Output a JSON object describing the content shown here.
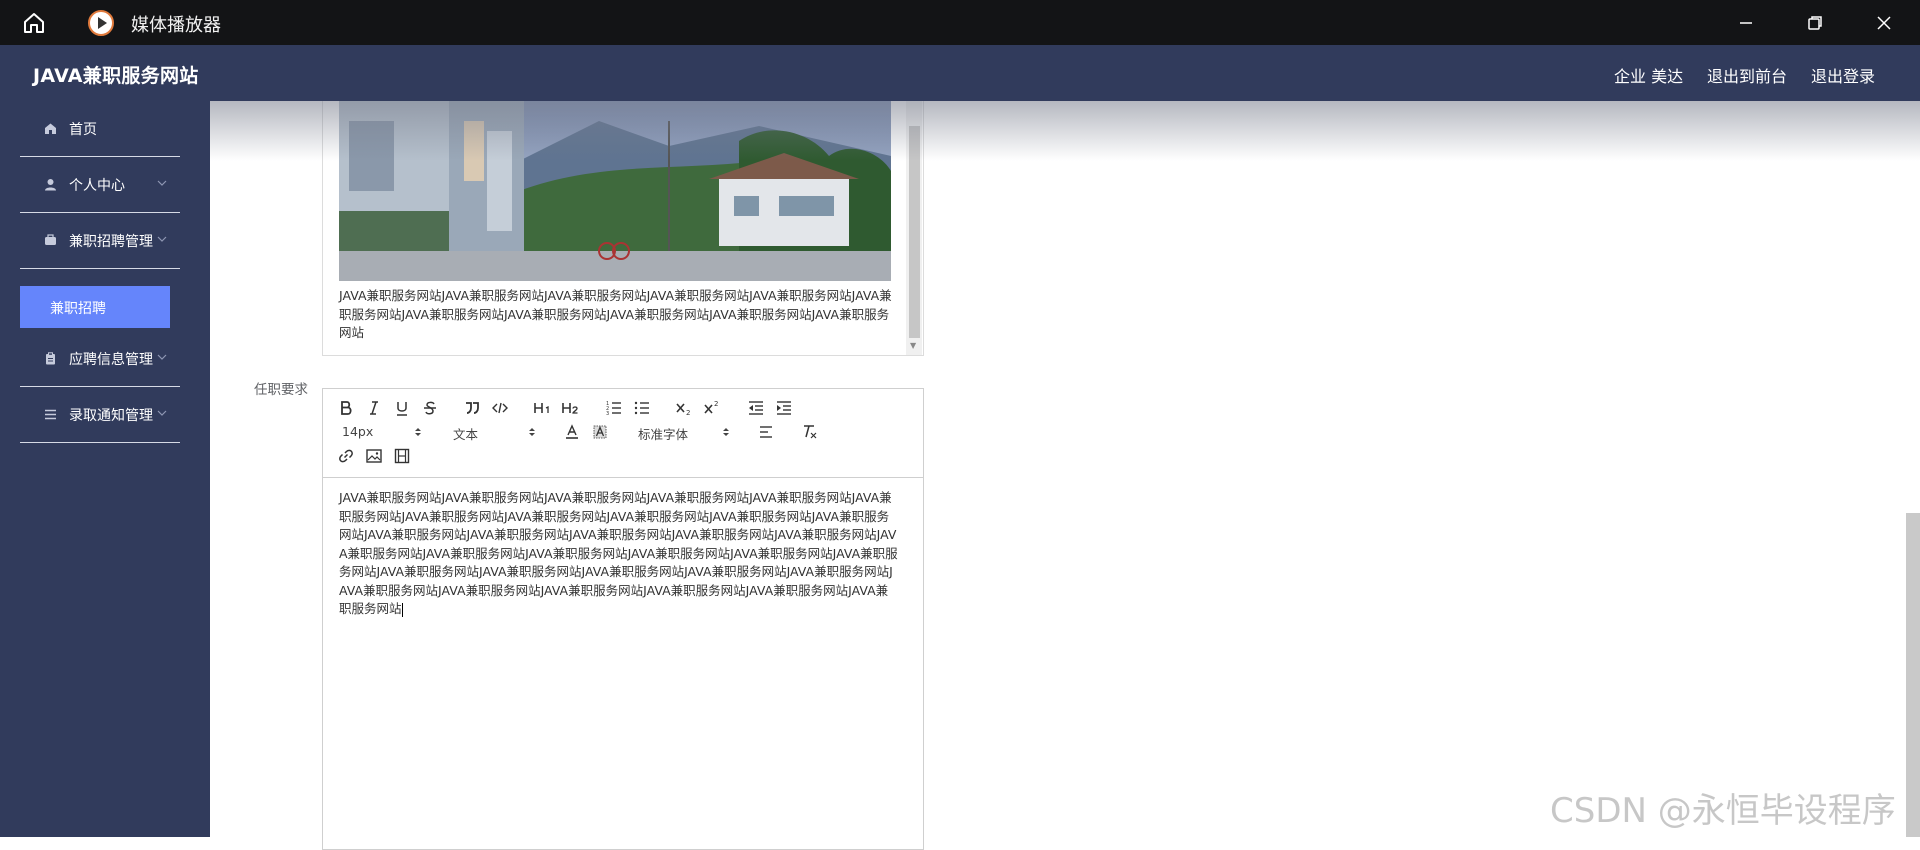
{
  "window": {
    "title": "媒体播放器",
    "icons": [
      "home-icon",
      "play-icon",
      "minimize-icon",
      "restore-icon",
      "close-icon"
    ]
  },
  "header": {
    "brand": "JAVA兼职服务网站",
    "user": "企业 美达",
    "to_front": "退出到前台",
    "logout": "退出登录"
  },
  "sidebar": {
    "items": [
      {
        "label": "首页",
        "icon": "home-icon"
      },
      {
        "label": "个人中心",
        "icon": "user-icon",
        "expandable": true
      },
      {
        "label": "兼职招聘管理",
        "icon": "briefcase-icon",
        "expandable": true
      },
      {
        "label": "应聘信息管理",
        "icon": "clipboard-icon",
        "expandable": true
      },
      {
        "label": "录取通知管理",
        "icon": "list-icon",
        "expandable": true
      }
    ],
    "active_sub": "兼职招聘"
  },
  "upper_editor": {
    "text": "JAVA兼职服务网站JAVA兼职服务网站JAVA兼职服务网站JAVA兼职服务网站JAVA兼职服务网站JAVA兼职服务网站JAVA兼职服务网站JAVA兼职服务网站JAVA兼职服务网站JAVA兼职服务网站JAVA兼职服务网站"
  },
  "requirements": {
    "label": "任职要求",
    "toolbar": {
      "font_size": "14px",
      "header": "文本",
      "font": "标准字体"
    },
    "text": "JAVA兼职服务网站JAVA兼职服务网站JAVA兼职服务网站JAVA兼职服务网站JAVA兼职服务网站JAVA兼职服务网站JAVA兼职服务网站JAVA兼职服务网站JAVA兼职服务网站JAVA兼职服务网站JAVA兼职服务网站JAVA兼职服务网站JAVA兼职服务网站JAVA兼职服务网站JAVA兼职服务网站JAVA兼职服务网站JAVA兼职服务网站JAVA兼职服务网站JAVA兼职服务网站JAVA兼职服务网站JAVA兼职服务网站JAVA兼职服务网站JAVA兼职服务网站JAVA兼职服务网站JAVA兼职服务网站JAVA兼职服务网站JAVA兼职服务网站JAVA兼职服务网站JAVA兼职服务网站JAVA兼职服务网站JAVA兼职服务网站JAVA兼职服务网站JAVA兼职服务网站"
  },
  "watermark": "CSDN @永恒毕设程序",
  "colors": {
    "titlebar": "#131416",
    "nav": "#313b5c",
    "active": "#6585fb"
  }
}
